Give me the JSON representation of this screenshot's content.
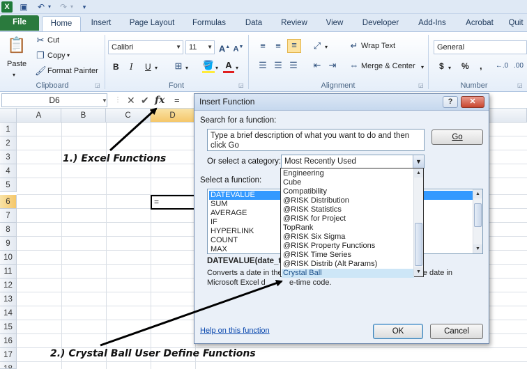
{
  "qat": {
    "undo": "↶",
    "redo": "↷"
  },
  "tabs": [
    "File",
    "Home",
    "Insert",
    "Page Layout",
    "Formulas",
    "Data",
    "Review",
    "View",
    "Developer",
    "Add-Ins",
    "Acrobat",
    "Quit"
  ],
  "ribbon": {
    "clipboard": {
      "label": "Clipboard",
      "paste": "Paste",
      "cut": "Cut",
      "copy": "Copy",
      "format_painter": "Format Painter"
    },
    "font": {
      "label": "Font",
      "font_name": "Calibri",
      "font_size": "11",
      "bold": "B",
      "italic": "I",
      "underline": "U"
    },
    "alignment": {
      "label": "Alignment",
      "wrap_text": "Wrap Text",
      "merge_center": "Merge & Center"
    },
    "number": {
      "label": "Number",
      "format": "General",
      "currency": "$",
      "percent": "%",
      "comma": ","
    }
  },
  "formula_bar": {
    "name_box": "D6",
    "cancel": "✕",
    "enter": "✔",
    "fx": "fx",
    "content": "="
  },
  "grid": {
    "columns": [
      "A",
      "B",
      "C",
      "D"
    ],
    "rows": [
      "1",
      "2",
      "3",
      "4",
      "5",
      "6",
      "7",
      "8",
      "9",
      "10",
      "11",
      "12",
      "13",
      "14",
      "15",
      "16",
      "17",
      "18"
    ],
    "active_cell_value": "="
  },
  "annotations": {
    "excel_functions": "1.) Excel Functions",
    "crystal_ball": "2.) Crystal Ball User Define Functions"
  },
  "dialog": {
    "title": "Insert Function",
    "help_btn": "?",
    "close_btn": "✕",
    "search_label": "Search for a function:",
    "search_text": "Type a brief description of what you want to do and then click Go",
    "go_btn": "Go",
    "category_label": "Or select a category:",
    "category_value": "Most Recently Used",
    "select_fn_label": "Select a function:",
    "functions": [
      "DATEVALUE",
      "SUM",
      "AVERAGE",
      "IF",
      "HYPERLINK",
      "COUNT",
      "MAX"
    ],
    "syntax": "DATEVALUE(date_t",
    "desc_left": "Converts a date in the",
    "desc_right": "the date in",
    "desc_line2_left": "Microsoft Excel d",
    "desc_line2_right": "e-time code.",
    "help_link": "Help on this function",
    "ok_btn": "OK",
    "cancel_btn": "Cancel"
  },
  "category_popup": {
    "items": [
      "Engineering",
      "Cube",
      "Compatibility",
      "@RISK Distribution",
      "@RISK Statistics",
      "@RISK for Project",
      "TopRank",
      "@RISK Six Sigma",
      "@RISK Property Functions",
      "@RISK Time Series",
      "@RISK Distrib (Alt Params)",
      "Crystal Ball"
    ],
    "highlighted_index": 11
  }
}
